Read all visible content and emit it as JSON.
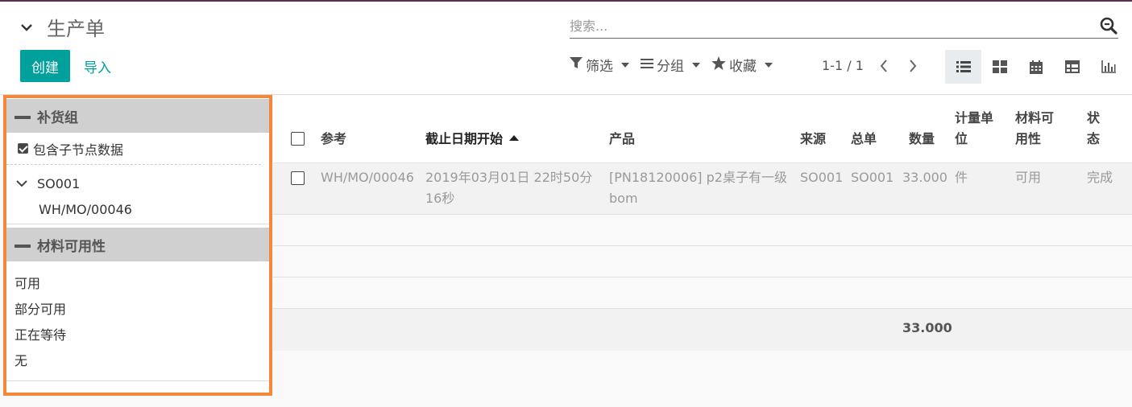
{
  "header": {
    "title": "生产单",
    "create_label": "创建",
    "import_label": "导入",
    "search_placeholder": "搜索...",
    "filters": [
      {
        "label": "筛选",
        "icon": "filter-icon"
      },
      {
        "label": "分组",
        "icon": "list-icon"
      },
      {
        "label": "收藏",
        "icon": "star-icon"
      }
    ],
    "pager": "1-1 / 1",
    "views": [
      "list-view-icon",
      "kanban-view-icon",
      "calendar-view-icon",
      "pivot-view-icon",
      "graph-view-icon"
    ]
  },
  "search_panel": {
    "group1": {
      "title": "补货组",
      "include_children_label": "包含子节点数据",
      "node": "SO001",
      "leaf": "WH/MO/00046"
    },
    "group2": {
      "title": "材料可用性",
      "items": [
        "可用",
        "部分可用",
        "正在等待",
        "无"
      ]
    }
  },
  "table": {
    "columns": {
      "ref": "参考",
      "deadline": "截止日期开始",
      "product": "产品",
      "source": "来源",
      "origin": "总单",
      "qty": "数量",
      "uom_l1": "计量单",
      "uom_l2": "位",
      "avail_l1": "材料可",
      "avail_l2": "用性",
      "state_l1": "状",
      "state_l2": "态"
    },
    "rows": [
      {
        "ref": "WH/MO/00046",
        "deadline_l1": "2019年03月01日 22时50分",
        "deadline_l2": "16秒",
        "product_l1": "[PN18120006] p2桌子有一级",
        "product_l2": "bom",
        "source": "SO001",
        "origin": "SO001",
        "qty": "33.000",
        "uom": "件",
        "avail": "可用",
        "state": "完成"
      }
    ],
    "total_qty": "33.000"
  },
  "colors": {
    "accent": "#00a09d",
    "highlight_border": "#f4883a",
    "top_bar": "#5c2d4d"
  }
}
